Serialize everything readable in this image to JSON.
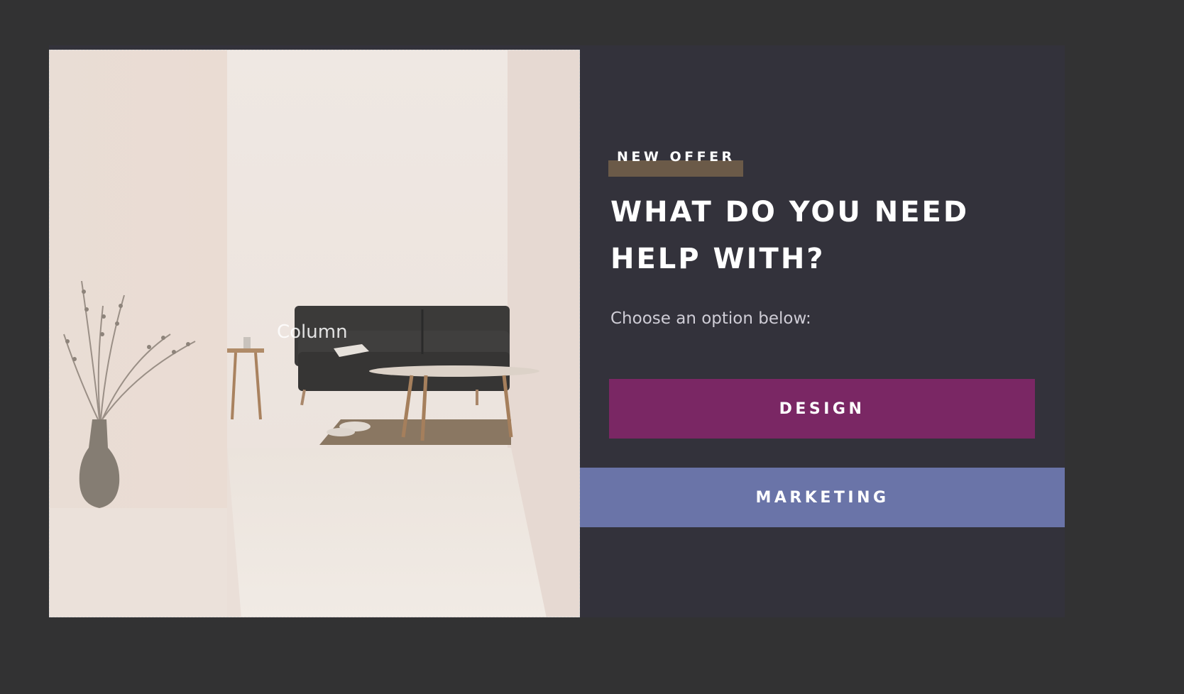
{
  "image_column": {
    "label": "Column",
    "image_description_icon": "living-room-photo"
  },
  "content": {
    "badge": "NEW OFFER",
    "headline": "WHAT DO YOU NEED HELP WITH?",
    "subtitle": "Choose an option below:"
  },
  "buttons": {
    "design": "DESIGN",
    "marketing": "MARKETING"
  },
  "colors": {
    "page_background": "#323233",
    "popup_background": "#33323b",
    "badge_bar": "#6b5a48",
    "design_button": "#7a2764",
    "marketing_button": "#6a74a8"
  }
}
